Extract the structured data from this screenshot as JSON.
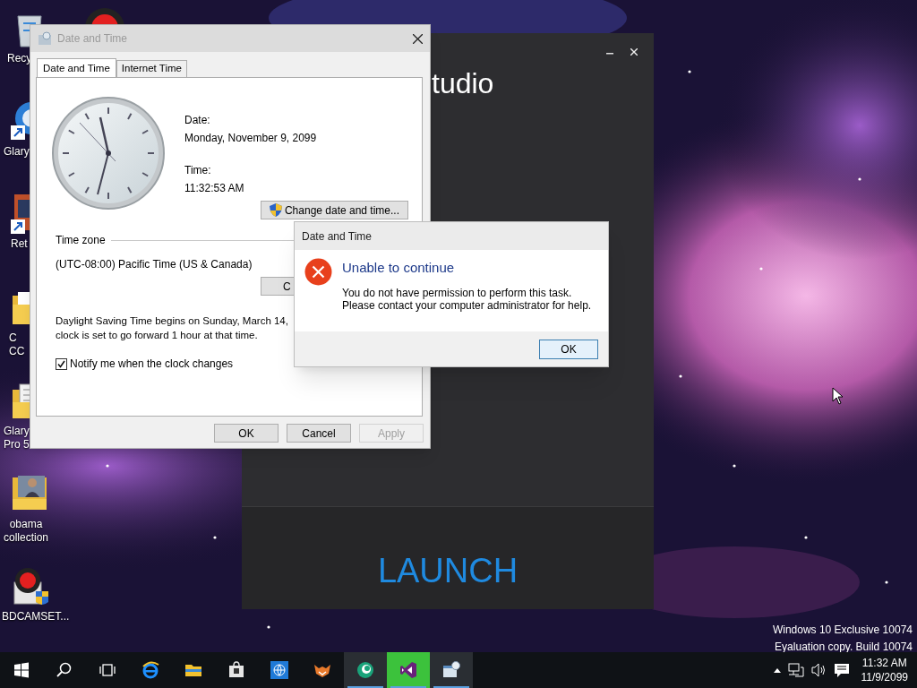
{
  "desktop_icons": [
    {
      "kind": "recycle-bin",
      "lines": [
        "Recy"
      ]
    },
    {
      "kind": "record"
    },
    {
      "kind": "shortcut-app",
      "lines": [
        "Glary"
      ]
    },
    {
      "kind": "shortcut-game",
      "lines": [
        "Ret"
      ]
    },
    {
      "kind": "folder",
      "lines": [
        "C",
        "CC"
      ]
    },
    {
      "kind": "folder-doc",
      "lines": [
        "Glary",
        "Pro 5"
      ]
    },
    {
      "kind": "folder-photo",
      "lines": [
        "obama",
        "collection"
      ]
    },
    {
      "kind": "installer",
      "lines": [
        "BDCAMSET..."
      ]
    }
  ],
  "launcher_window": {
    "title_fragment": "tudio",
    "action": "LAUNCH"
  },
  "date_time_window": {
    "title": "Date and Time",
    "tabs": [
      {
        "label": "Date and Time",
        "selected": true
      },
      {
        "label": "Internet Time",
        "selected": false
      }
    ],
    "date_label": "Date:",
    "date": "Monday, November 9, 2099",
    "time_label": "Time:",
    "time": "11:32:53 AM",
    "change_button": "Change date and time...",
    "time_zone_heading": "Time zone",
    "time_zone": "(UTC-08:00) Pacific Time (US & Canada)",
    "change_zone_button": "C",
    "dst_lines": [
      "Daylight Saving Time begins on Sunday, March 14,",
      "clock is set to go forward 1 hour at that time."
    ],
    "notify": {
      "label": "Notify me when the clock changes",
      "checked": true
    },
    "buttons": [
      {
        "label": "OK",
        "disabled": false
      },
      {
        "label": "Cancel",
        "disabled": false
      },
      {
        "label": "Apply",
        "disabled": true
      }
    ]
  },
  "error_dialog": {
    "title": "Date and Time",
    "heading": "Unable to continue",
    "message_lines": [
      "You do not have permission to perform this task.",
      "Please contact your computer administrator for help."
    ],
    "button": "OK"
  },
  "system_watermark": [
    "Windows 10 Exclusive 10074",
    "Eyaluation copy. Build 10074"
  ],
  "taskbar": {
    "items": [
      {
        "kind": "start",
        "selected": false,
        "running": false
      },
      {
        "kind": "search",
        "selected": false,
        "running": false
      },
      {
        "kind": "task-view",
        "selected": false,
        "running": false
      },
      {
        "kind": "browser",
        "selected": false,
        "running": false
      },
      {
        "kind": "explorer",
        "selected": false,
        "running": false
      },
      {
        "kind": "store",
        "selected": false,
        "running": false
      },
      {
        "kind": "globe",
        "selected": false,
        "running": false
      },
      {
        "kind": "fox",
        "selected": false,
        "running": false
      },
      {
        "kind": "green-circle",
        "selected": false,
        "running": true
      },
      {
        "kind": "visual-studio",
        "selected": true,
        "running": true
      },
      {
        "kind": "date-time",
        "selected": false,
        "running": true
      }
    ],
    "clock_time": "11:32 AM",
    "clock_date": "11/9/2099"
  }
}
